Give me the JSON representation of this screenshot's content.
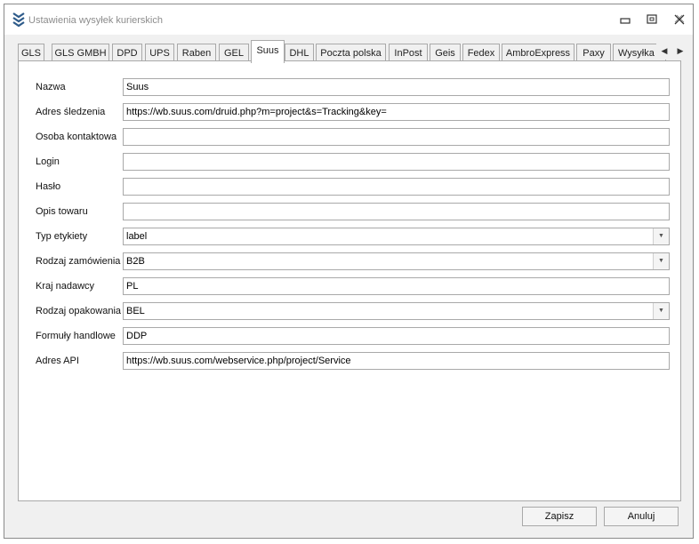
{
  "window": {
    "title": "Ustawienia wysyłek kurierskich"
  },
  "tabs": [
    {
      "label": "GLS"
    },
    {
      "label": "GLS GMBH"
    },
    {
      "label": "DPD"
    },
    {
      "label": "UPS"
    },
    {
      "label": "Raben"
    },
    {
      "label": "GEL"
    },
    {
      "label": "Suus",
      "active": true
    },
    {
      "label": "DHL"
    },
    {
      "label": "Poczta polska"
    },
    {
      "label": "InPost"
    },
    {
      "label": "Geis"
    },
    {
      "label": "Fedex"
    },
    {
      "label": "AmbroExpress"
    },
    {
      "label": "Paxy"
    },
    {
      "label": "Wysyłka"
    }
  ],
  "form": {
    "fields": [
      {
        "label": "Nazwa",
        "value": "Suus",
        "type": "text"
      },
      {
        "label": "Adres śledzenia",
        "value": "https://wb.suus.com/druid.php?m=project&s=Tracking&key=",
        "type": "text"
      },
      {
        "label": "Osoba kontaktowa",
        "value": "",
        "type": "text"
      },
      {
        "label": "Login",
        "value": "",
        "type": "text"
      },
      {
        "label": "Hasło",
        "value": "",
        "type": "text"
      },
      {
        "label": "Opis towaru",
        "value": "",
        "type": "text"
      },
      {
        "label": "Typ etykiety",
        "value": "label",
        "type": "select"
      },
      {
        "label": "Rodzaj zamówienia",
        "value": "B2B",
        "type": "select"
      },
      {
        "label": "Kraj nadawcy",
        "value": "PL",
        "type": "text"
      },
      {
        "label": "Rodzaj opakowania",
        "value": "BEL",
        "type": "select"
      },
      {
        "label": "Formuły handlowe",
        "value": "DDP",
        "type": "text"
      },
      {
        "label": "Adres API",
        "value": "https://wb.suus.com/webservice.php/project/Service",
        "type": "text"
      }
    ]
  },
  "buttons": {
    "save": "Zapisz",
    "cancel": "Anuluj"
  },
  "icons": {
    "app": "chevrons-down-icon",
    "minimize": "minimize-icon",
    "maximize": "maximize-icon",
    "close": "close-icon",
    "tab_left": "arrow-left-icon",
    "tab_right": "arrow-right-icon",
    "dropdown": "chevron-down-icon"
  },
  "colors": {
    "accent": "#2e5b8a",
    "title_text": "#8c8c8c"
  }
}
